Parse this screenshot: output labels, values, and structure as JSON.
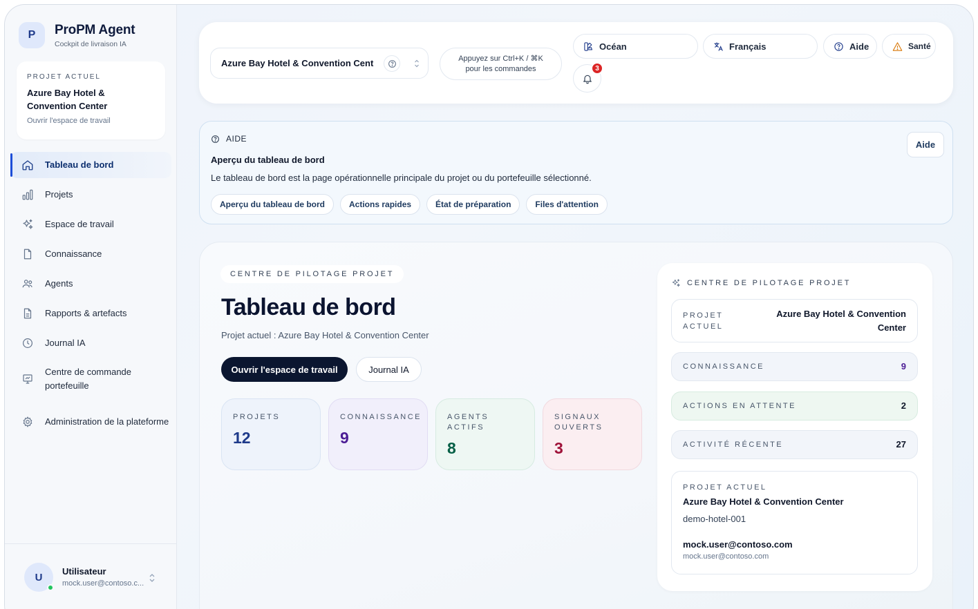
{
  "brand": {
    "initial": "P",
    "title": "ProPM Agent",
    "subtitle": "Cockpit de livraison IA"
  },
  "sidebar": {
    "project_card": {
      "label": "PROJET ACTUEL",
      "name": "Azure Bay Hotel & Convention Center",
      "link": "Ouvrir l'espace de travail"
    },
    "items": [
      {
        "label": "Tableau de bord",
        "icon": "home-icon",
        "active": true
      },
      {
        "label": "Projets",
        "icon": "bar-chart-icon"
      },
      {
        "label": "Espace de travail",
        "icon": "sparkles-icon"
      },
      {
        "label": "Connaissance",
        "icon": "file-icon"
      },
      {
        "label": "Agents",
        "icon": "users-icon"
      },
      {
        "label": "Rapports & artefacts",
        "icon": "file-text-icon"
      },
      {
        "label": "Journal IA",
        "icon": "clock-icon"
      },
      {
        "label": "Centre de commande portefeuille",
        "icon": "presentation-icon"
      },
      {
        "label": "Administration de la plateforme",
        "icon": "gear-icon"
      }
    ],
    "user": {
      "initial": "U",
      "name": "Utilisateur",
      "email": "mock.user@contoso.c..."
    }
  },
  "topbar": {
    "project_select": "Azure Bay Hotel & Convention Cent",
    "command_hint_line1": "Appuyez sur Ctrl+K / ⌘K",
    "command_hint_line2": "pour les commandes",
    "theme": "Océan",
    "language": "Français",
    "help": "Aide",
    "health": "Santé",
    "notifications": "3"
  },
  "help_panel": {
    "tag": "AIDE",
    "title": "Aperçu du tableau de bord",
    "description": "Le tableau de bord est la page opérationnelle principale du projet ou du portefeuille sélectionné.",
    "chips": [
      "Aperçu du tableau de bord",
      "Actions rapides",
      "État de préparation",
      "Files d'attention"
    ],
    "button": "Aide"
  },
  "dashboard": {
    "eyebrow": "CENTRE DE PILOTAGE PROJET",
    "title": "Tableau de bord",
    "subtitle": "Projet actuel : Azure Bay Hotel & Convention Center",
    "primary_button": "Ouvrir l'espace de travail",
    "secondary_button": "Journal IA",
    "stats": [
      {
        "label": "PROJETS",
        "value": "12"
      },
      {
        "label": "CONNAISSANCE",
        "value": "9"
      },
      {
        "label": "AGENTS ACTIFS",
        "value": "8"
      },
      {
        "label": "SIGNAUX OUVERTS",
        "value": "3"
      }
    ],
    "panel": {
      "header": "CENTRE DE PILOTAGE PROJET",
      "current_project_label": "PROJET ACTUEL",
      "current_project_value": "Azure Bay Hotel & Convention Center",
      "knowledge_label": "CONNAISSANCE",
      "knowledge_value": "9",
      "pending_label": "ACTIONS EN ATTENTE",
      "pending_value": "2",
      "activity_label": "ACTIVITÉ RÉCENTE",
      "activity_value": "27",
      "detail": {
        "label": "PROJET ACTUEL",
        "name": "Azure Bay Hotel & Convention Center",
        "id": "demo-hotel-001",
        "email": "mock.user@contoso.com",
        "email_secondary": "mock.user@contoso.com"
      }
    }
  },
  "colors": {
    "primary_dark": "#0b1630",
    "accent": "#1d4ed8",
    "badge": "#dc2626",
    "online": "#22c55e"
  }
}
